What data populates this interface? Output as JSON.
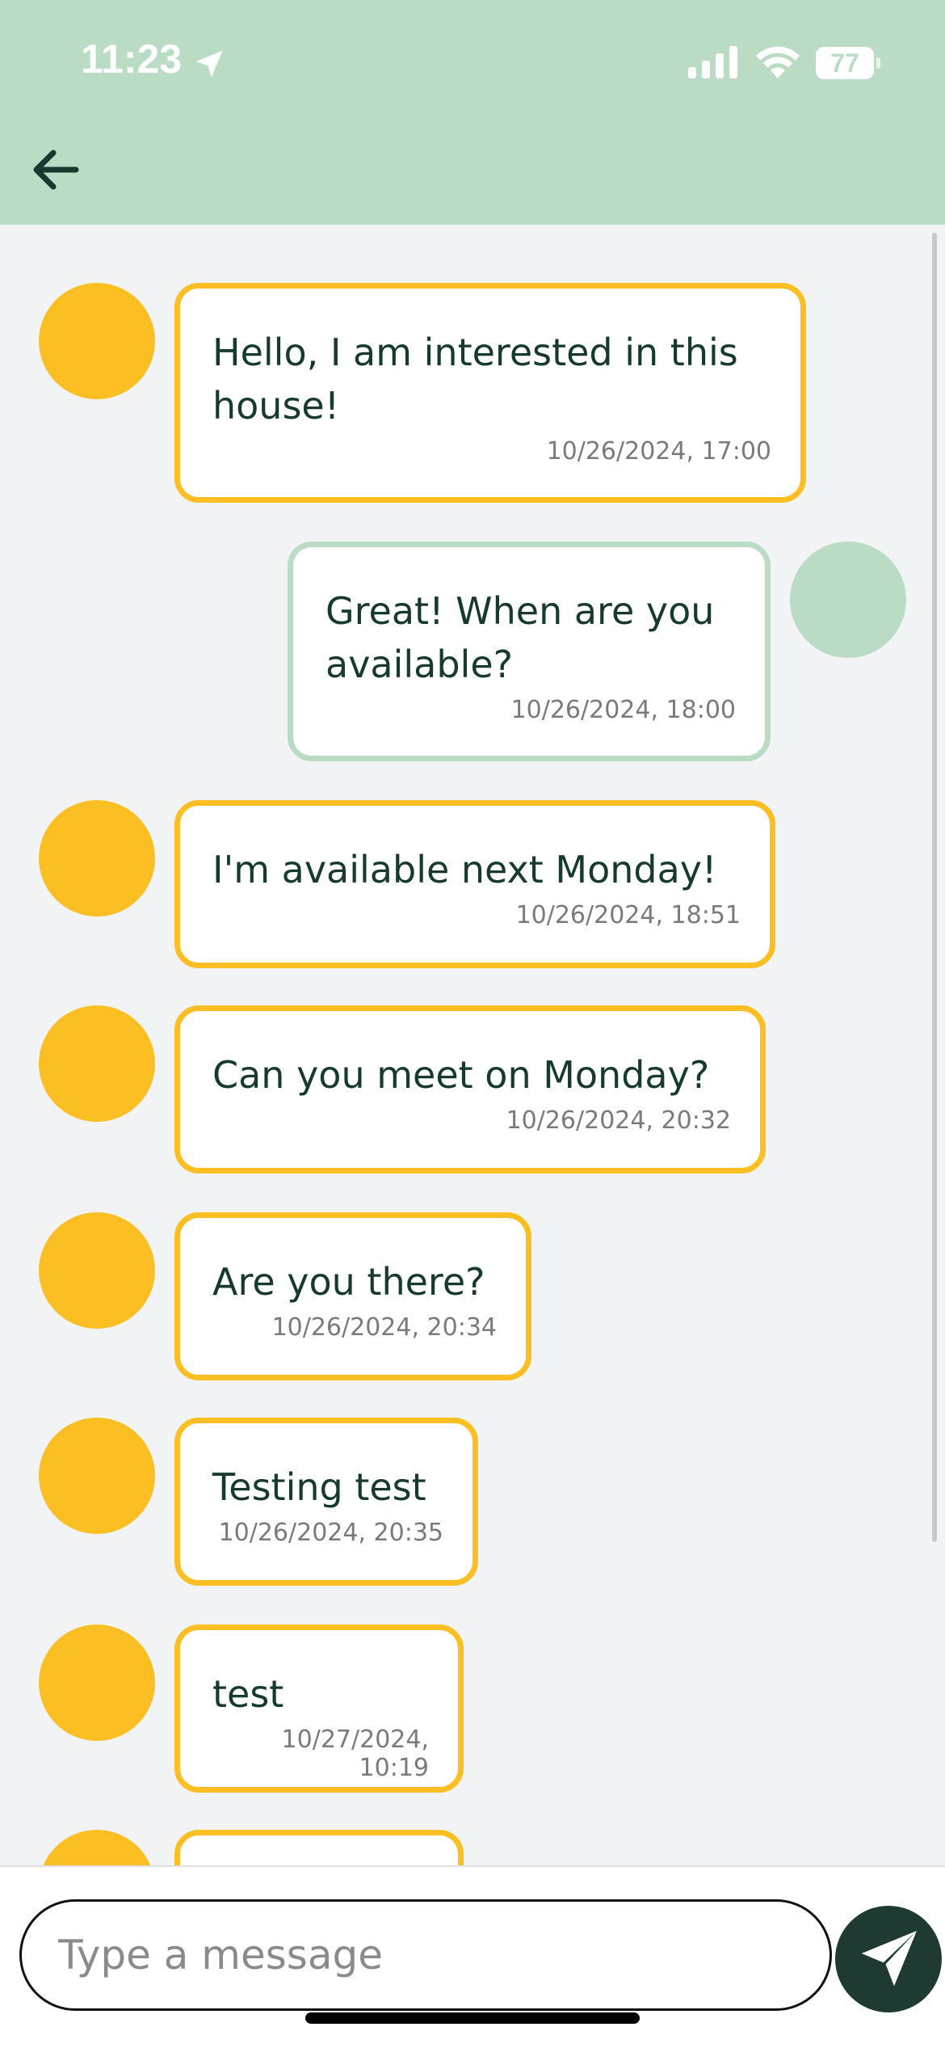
{
  "status_bar": {
    "time": "11:23",
    "battery": "77",
    "icons": [
      "location-arrow-icon",
      "signal-icon",
      "wifi-icon",
      "battery-icon"
    ]
  },
  "header": {
    "back_icon": "arrow-left-icon"
  },
  "colors": {
    "header_bg": "#badbc4",
    "other_accent": "#fbbf24",
    "me_accent": "#badbc4",
    "text": "#173a2f",
    "chat_bg": "#f2f3f5",
    "send_button": "#1f3a33"
  },
  "messages": [
    {
      "sender": "other",
      "text": "Hello, I am interested in this\nhouse!",
      "time": "10/26/2024, 17:00"
    },
    {
      "sender": "me",
      "text": "Great! When are you\navailable?",
      "time": "10/26/2024, 18:00"
    },
    {
      "sender": "other",
      "text": "I'm available next Monday!",
      "time": "10/26/2024, 18:51"
    },
    {
      "sender": "other",
      "text": "Can you meet on Monday?",
      "time": "10/26/2024, 20:32"
    },
    {
      "sender": "other",
      "text": "Are you there?",
      "time": "10/26/2024, 20:34"
    },
    {
      "sender": "other",
      "text": "Testing test",
      "time": "10/26/2024, 20:35"
    },
    {
      "sender": "other",
      "text": "test",
      "time": "10/27/2024, 10:19"
    }
  ],
  "composer": {
    "placeholder": "Type a message",
    "value": "",
    "send_icon": "paper-plane-icon"
  }
}
